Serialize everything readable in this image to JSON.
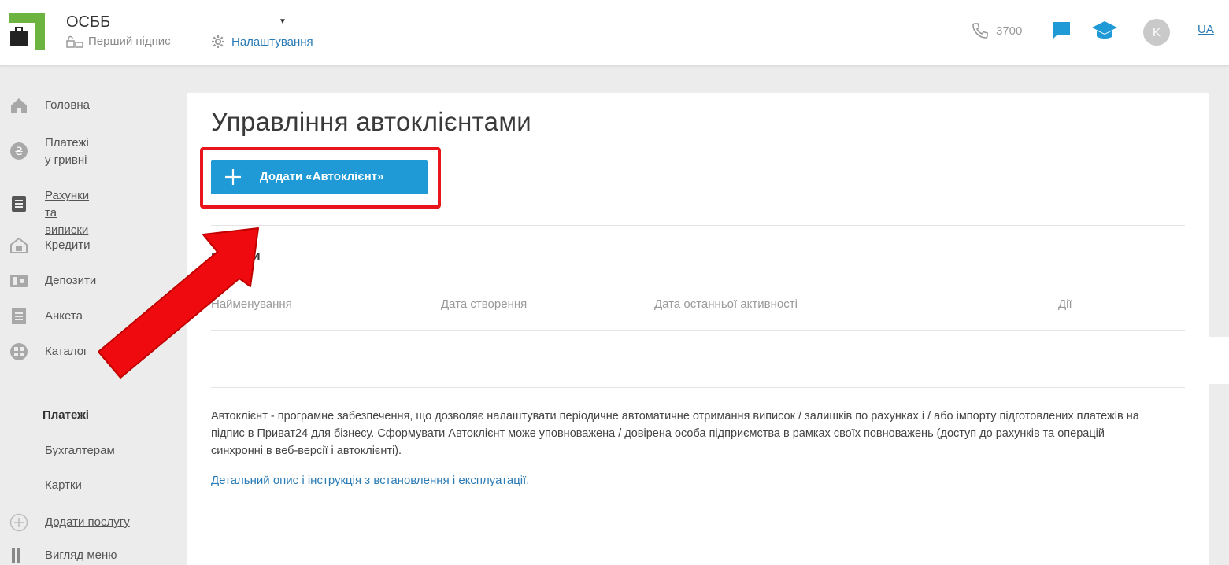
{
  "header": {
    "org_name": "ОСББ",
    "first_sign": "Перший підпис",
    "settings": "Налаштування",
    "phone": "3700",
    "avatar_letter": "K",
    "lang": "UA"
  },
  "sidebar": {
    "items": [
      {
        "label": "Головна",
        "icon": "home-icon"
      },
      {
        "label": "Платежі\nу гривні",
        "icon": "hryvnia-icon"
      },
      {
        "label": "Рахунки\nта виписки",
        "icon": "statement-icon"
      },
      {
        "label": "Кредити",
        "icon": "credit-icon"
      },
      {
        "label": "Депозити",
        "icon": "deposit-icon"
      },
      {
        "label": "Анкета",
        "icon": "form-icon"
      },
      {
        "label": "Каталог",
        "icon": "catalog-icon"
      }
    ],
    "section_title": "Платежі",
    "sub_items": [
      "Бухгалтерам",
      "Картки",
      "Додати послугу",
      "Вигляд меню"
    ]
  },
  "main": {
    "title": "Управління автоклієнтами",
    "add_button": "Додати «Автоклієнт»",
    "section_title": "клієнти",
    "columns": [
      "Найменування",
      "Дата створення",
      "Дата останньої активності",
      "Дії"
    ],
    "description": "Автоклієнт - програмне забезпечення, що дозволяє налаштувати періодичне автоматичне отримання виписок / залишків по рахунках і / або імпорту підготовлених платежів на підпис в Приват24 для бізнесу. Сформувати Автоклієнт може уповноважена / довірена особа підприємства в рамках своїх повноважень (доступ до рахунків та операцій синхронні в веб-версії і автоклієнті).",
    "doc_link": "Детальний опис і інструкція з встановлення і експлуатації."
  },
  "colors": {
    "brand_green": "#6cb33f",
    "accent_blue": "#1f9ad6",
    "link_blue": "#2a7bb5",
    "annotation_red": "#e8151b"
  }
}
